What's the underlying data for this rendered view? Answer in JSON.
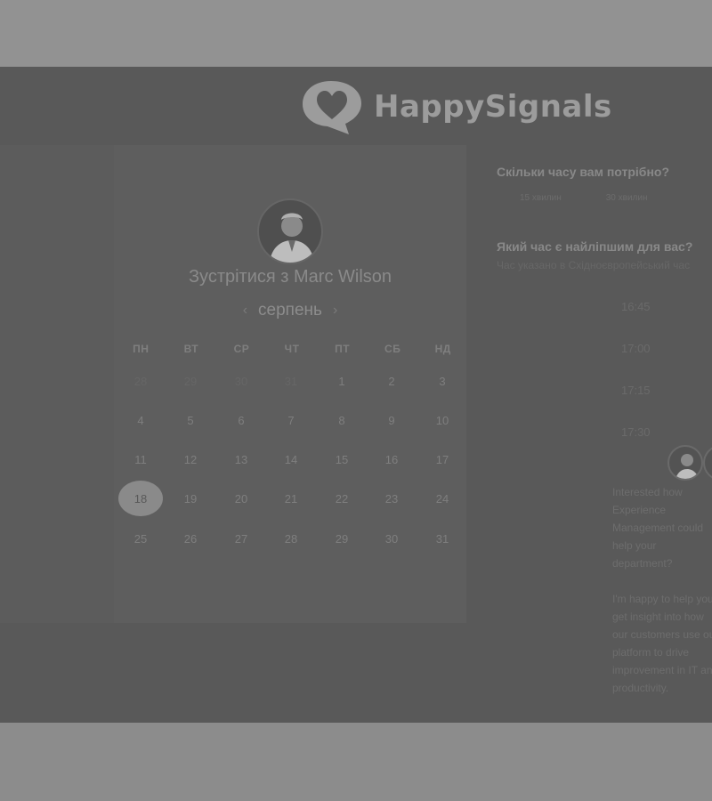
{
  "brand": {
    "name": "HappySignals",
    "logo_icon": "heart-chat-bubble-icon"
  },
  "meeting": {
    "title": "Зустрітися з Marc Wilson",
    "host_avatar": "person-avatar-icon"
  },
  "calendar": {
    "month": "серпень",
    "prev_icon": "chevron-left-icon",
    "next_icon": "chevron-right-icon",
    "weekdays": [
      "ПН",
      "ВТ",
      "СР",
      "ЧТ",
      "ПТ",
      "СБ",
      "НД"
    ],
    "rows": [
      [
        "28",
        "29",
        "30",
        "31",
        "1",
        "2",
        "3"
      ],
      [
        "4",
        "5",
        "6",
        "7",
        "8",
        "9",
        "10"
      ],
      [
        "11",
        "12",
        "13",
        "14",
        "15",
        "16",
        "17"
      ],
      [
        "18",
        "19",
        "20",
        "21",
        "22",
        "23",
        "24"
      ],
      [
        "25",
        "26",
        "27",
        "28",
        "29",
        "30",
        "31"
      ]
    ],
    "selected_day": "18"
  },
  "duration": {
    "question": "Скільки часу вам потрібно?",
    "options": [
      "15 хвилин",
      "30 хвилин"
    ]
  },
  "timeslots": {
    "question": "Який час є найліпшим для вас?",
    "timezone_note": "Час указано в Східноєвропейський час",
    "slots": [
      "16:45",
      "17:00",
      "17:15",
      "17:30"
    ]
  },
  "host_message": {
    "paragraphs": [
      "Interested how Experience Management could help your department?",
      "I'm happy to help you get insight into how our customers use our platform to drive improvement in IT and productivity."
    ]
  }
}
